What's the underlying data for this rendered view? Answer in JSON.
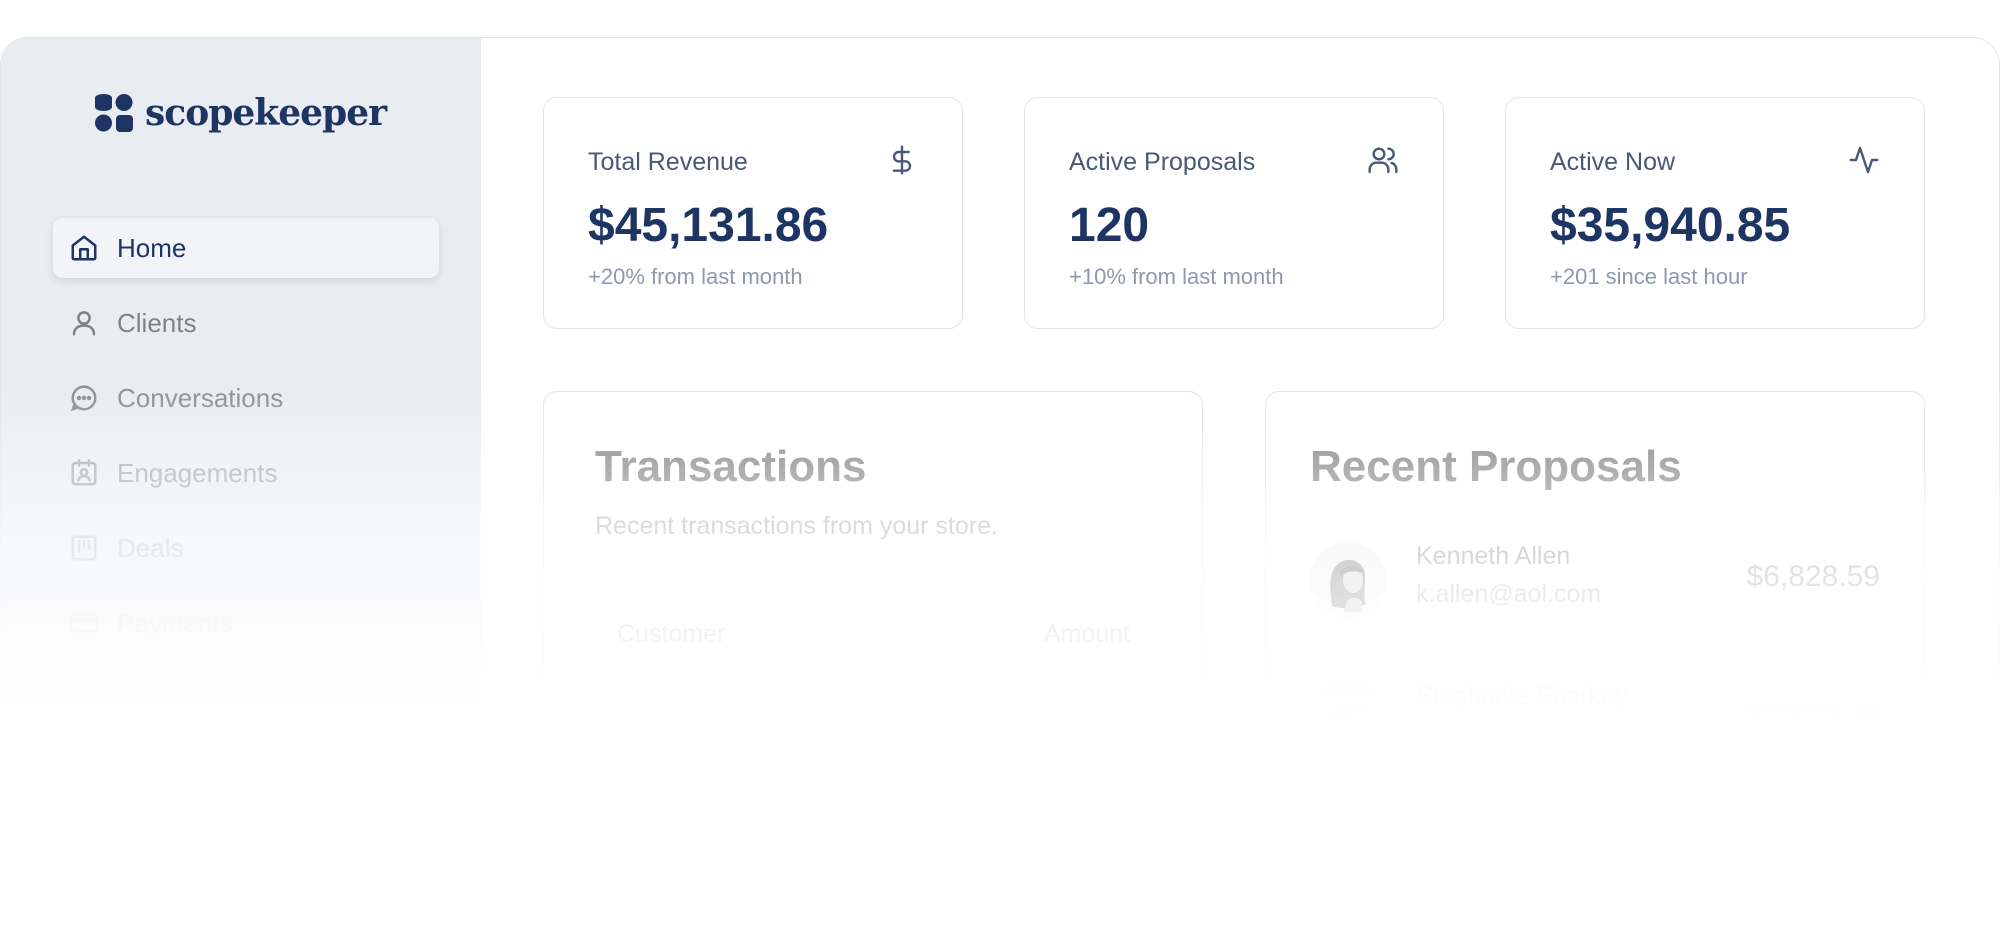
{
  "brand": {
    "name": "scopekeeper",
    "logo_icon": "clover-logo-icon"
  },
  "sidebar": {
    "items": [
      {
        "label": "Home",
        "icon": "home-icon",
        "active": true
      },
      {
        "label": "Clients",
        "icon": "user-icon"
      },
      {
        "label": "Conversations",
        "icon": "chat-bubble-icon"
      },
      {
        "label": "Engagements",
        "icon": "calendar-badge-icon"
      },
      {
        "label": "Deals",
        "icon": "kanban-icon"
      },
      {
        "label": "Payments",
        "icon": "credit-card-icon"
      }
    ]
  },
  "stats": [
    {
      "label": "Total Revenue",
      "value": "$45,131.86",
      "sub": "+20% from last month",
      "icon": "dollar-icon"
    },
    {
      "label": "Active Proposals",
      "value": "120",
      "sub": "+10% from last month",
      "icon": "users-icon"
    },
    {
      "label": "Active Now",
      "value": "$35,940.85",
      "sub": "+201 since last hour",
      "icon": "activity-icon"
    }
  ],
  "transactions": {
    "title": "Transactions",
    "description": "Recent transactions from your store.",
    "columns": [
      "Customer",
      "Amount"
    ]
  },
  "recent_proposals": {
    "title": "Recent Proposals",
    "items": [
      {
        "name": "Kenneth Allen",
        "email": "k.allen@aol.com",
        "amount": "$6,828.59"
      },
      {
        "name": "Stephanie Sharkey",
        "email": "",
        "amount": "$7,524.46"
      }
    ]
  },
  "colors": {
    "brand_navy": "#1e3564",
    "sidebar_bg": "#e9ecf1",
    "muted_text": "#8d98b0"
  }
}
